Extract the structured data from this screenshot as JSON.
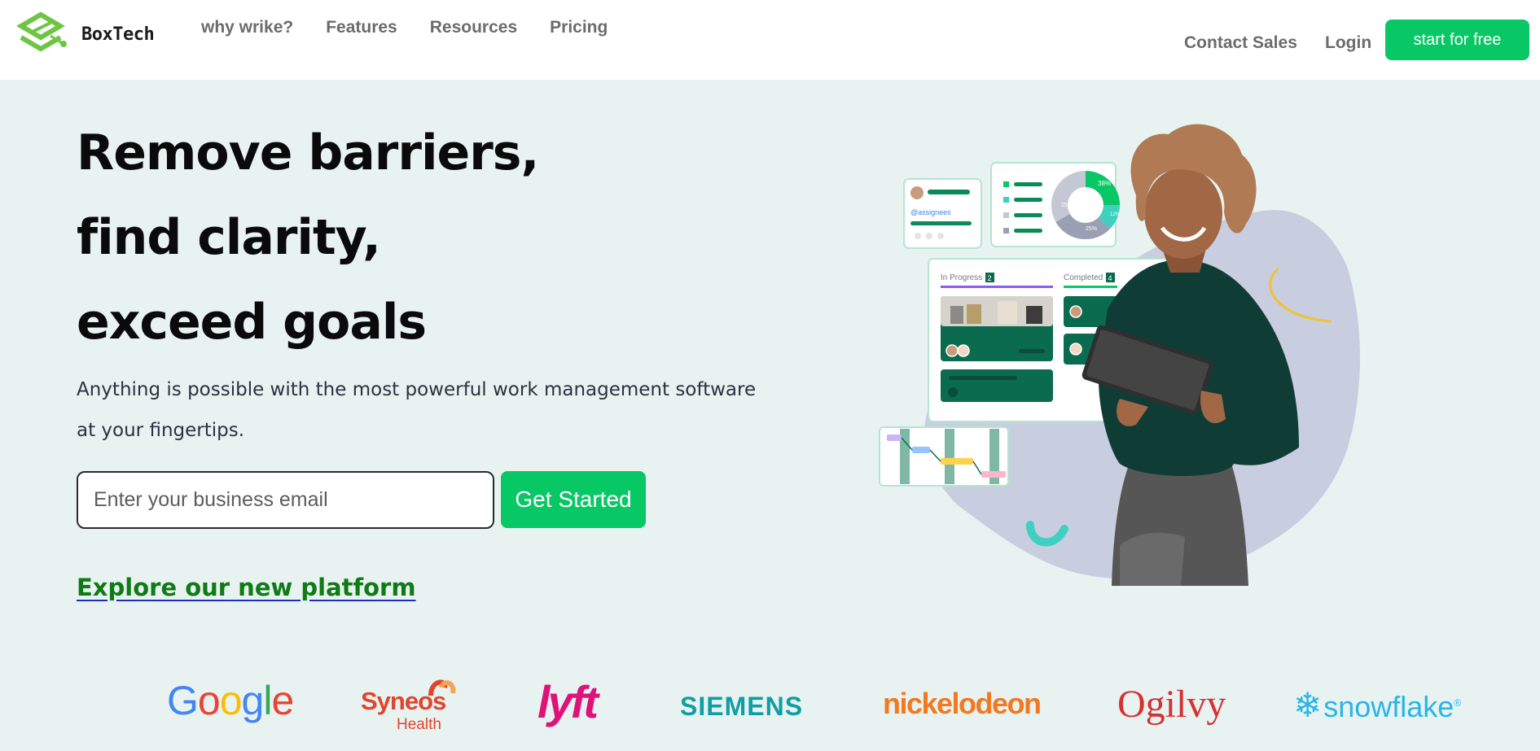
{
  "header": {
    "logo_text": "BoxTech",
    "nav": [
      "why wrike?",
      "Features",
      "Resources",
      "Pricing"
    ],
    "contact_sales": "Contact Sales",
    "login": "Login",
    "cta": "start for free"
  },
  "hero": {
    "headline_lines": [
      "Remove barriers,",
      "find clarity,",
      "exceed goals"
    ],
    "subtitle": "Anything is possible with the most powerful work management software at your fingertips.",
    "email_placeholder": "Enter your business email",
    "email_value": "",
    "get_started": "Get Started",
    "explore_link": "Explore our new platform",
    "illustration": {
      "assignee_tag": "@assignees",
      "board_columns": [
        {
          "label": "In Progress",
          "count": "2"
        },
        {
          "label": "Completed",
          "count": "4"
        }
      ],
      "donut_labels": [
        "38%",
        "25%",
        "25%",
        "12%"
      ]
    }
  },
  "logos": {
    "google": "Google",
    "syneos": "Syneos",
    "syneos_sub": "Health",
    "lyft": "lyft",
    "siemens": "SIEMENS",
    "nickelodeon": "nickelodeon",
    "ogilvy": "Ogilvy",
    "snowflake": "snowflake"
  },
  "colors": {
    "accent": "#08c765",
    "page_bg": "#e8f3f1",
    "link": "#0f7a16",
    "nav_text": "#6b6b6b"
  }
}
